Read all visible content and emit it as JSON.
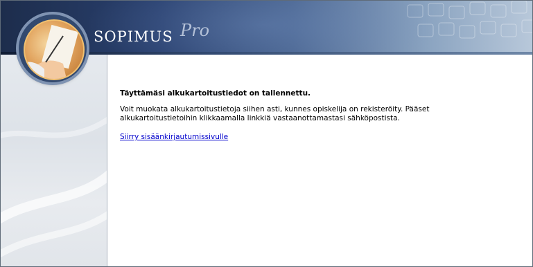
{
  "brand": {
    "name": "SOPIMUS",
    "suffix": "Pro"
  },
  "content": {
    "title": "Täyttämäsi alkukartoitustiedot on tallennettu.",
    "message_line1": "Voit muokata alkukartoitustietoja siihen asti, kunnes opiskelija on rekisteröity. Pääset",
    "message_line2": "alkukartoitustietoihin klikkaamalla linkkiä vastaanottamastasi sähköpostista.",
    "link_label": "Siirry sisäänkirjautumissivulle"
  },
  "colors": {
    "header_dark": "#1d2d4c",
    "sidebar_bg": "#e5e9ee",
    "link": "#0000cc"
  }
}
